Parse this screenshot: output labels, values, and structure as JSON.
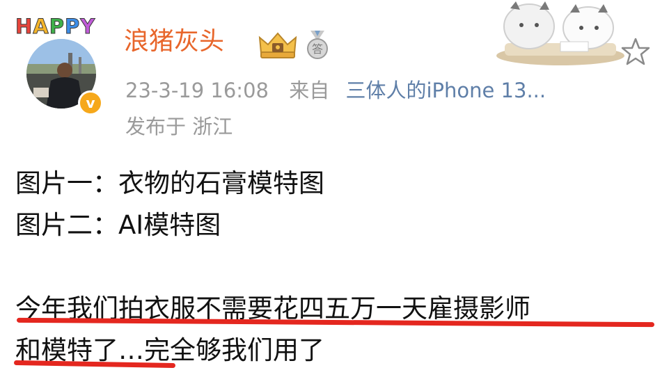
{
  "user": {
    "avatar_caption": "HAPPY",
    "name": "浪猪灰头",
    "verified_badge": "v",
    "crown_icon": "crown-badge-icon",
    "medal_icon": "medal-badge-icon",
    "medal_text": "答"
  },
  "post_meta": {
    "timestamp": "23-3-19 16:08",
    "from_label": "来自",
    "source": "三体人的iPhone 13...",
    "location": "发布于 浙江"
  },
  "content": {
    "lines": [
      "图片一：衣物的石膏模特图",
      "图片二：AI模特图",
      "今年我们拍衣服不需要花四五万一天雇摄影师",
      "和模特了…完全够我们用了"
    ]
  },
  "colors": {
    "username": "#e8662b",
    "meta_gray": "#9a9a9a",
    "source_link": "#5f7fa8",
    "underline": "#e4271f",
    "verified": "#f6a81b"
  },
  "icons": [
    "star-icon",
    "sticker-cats-icon"
  ]
}
